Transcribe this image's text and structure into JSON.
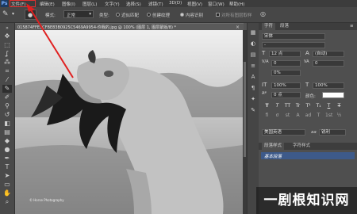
{
  "app": {
    "logo": "Ps"
  },
  "menu": [
    "文件(F)",
    "编辑(E)",
    "图像(I)",
    "图层(L)",
    "文字(Y)",
    "选择(S)",
    "滤镜(T)",
    "3D(D)",
    "视图(V)",
    "窗口(W)",
    "帮助(H)"
  ],
  "options": {
    "mode_label": "模式:",
    "mode_value": "正常",
    "type_label": "类型:",
    "radio1": "近似匹配",
    "radio2": "创建纹理",
    "radio3": "内容识别",
    "sample_all": "对所有图层取样"
  },
  "document": {
    "tab_title": "015874FFE3CFBE83B0925C5469A9954-你我的.jpg @ 100% (图层 1, 图层蒙版/8) *"
  },
  "canvas": {
    "signature": "© Horse Photography"
  },
  "character_panel": {
    "tabs": [
      "字符",
      "段落"
    ],
    "font_family": "宋体",
    "font_style": "-",
    "font_size": "12 点",
    "leading": "(自动)",
    "kerning": "0",
    "tracking": "0",
    "tracking_label": "VA",
    "percent_label": "0%",
    "vscale": "100%",
    "hscale": "100%",
    "baseline": "0 点",
    "color_label": "颜色:",
    "style_buttons": [
      "T",
      "T",
      "TT",
      "Tr",
      "T¹",
      "T₁",
      "T",
      "T"
    ],
    "ot_buttons": [
      "fi",
      "ơ",
      "st",
      "A",
      "ad",
      "T",
      "1st",
      "½"
    ],
    "language": "美国英语",
    "aa_label": "aa",
    "aa_value": "锐利"
  },
  "paragraph_styles": {
    "tabs": [
      "段落样式",
      "字符样式"
    ],
    "item": "基本段落"
  },
  "watermark": "一剧根知识网",
  "colors": {
    "accent_red": "#e02020",
    "panel_bg": "#4f4f4f",
    "selected_style": "#3d5a8a"
  }
}
